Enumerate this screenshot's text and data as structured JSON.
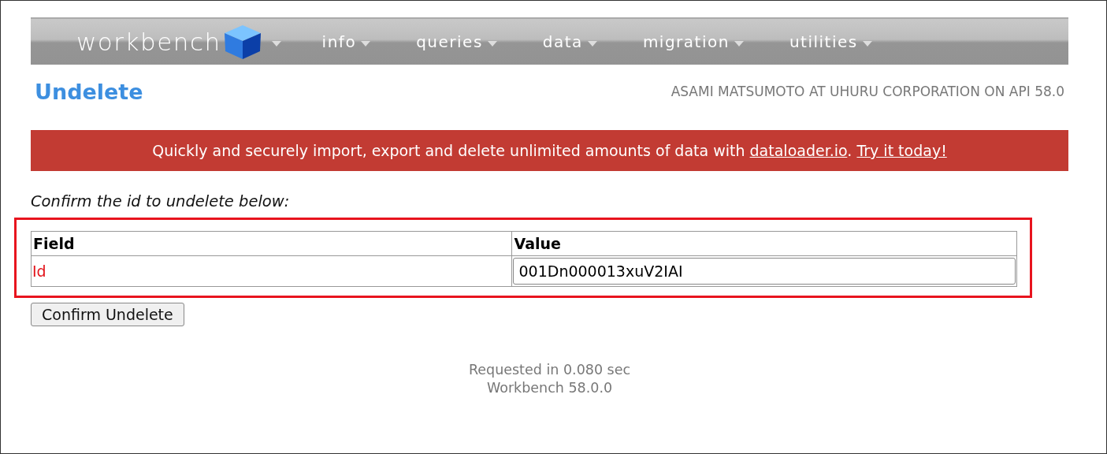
{
  "nav": {
    "logo": "workbench",
    "items": [
      {
        "label": "info"
      },
      {
        "label": "queries"
      },
      {
        "label": "data"
      },
      {
        "label": "migration"
      },
      {
        "label": "utilities"
      }
    ]
  },
  "page_title": "Undelete",
  "user_info": "ASAMI MATSUMOTO AT UHURU CORPORATION ON API 58.0",
  "banner": [
    {
      "kind": "text",
      "text": "Quickly and securely import, export and delete unlimited amounts of data with "
    },
    {
      "kind": "link",
      "text": "dataloader.io"
    },
    {
      "kind": "text",
      "text": ". "
    },
    {
      "kind": "link",
      "text": "Try it today!"
    }
  ],
  "instruction": "Confirm the id to undelete below:",
  "table": {
    "columns": [
      "Field",
      "Value"
    ],
    "rows": [
      {
        "field": "Id",
        "value": "001Dn000013xuV2IAI"
      }
    ]
  },
  "button": "Confirm Undelete",
  "footer": [
    "Requested in 0.080 sec",
    "Workbench 58.0.0"
  ]
}
